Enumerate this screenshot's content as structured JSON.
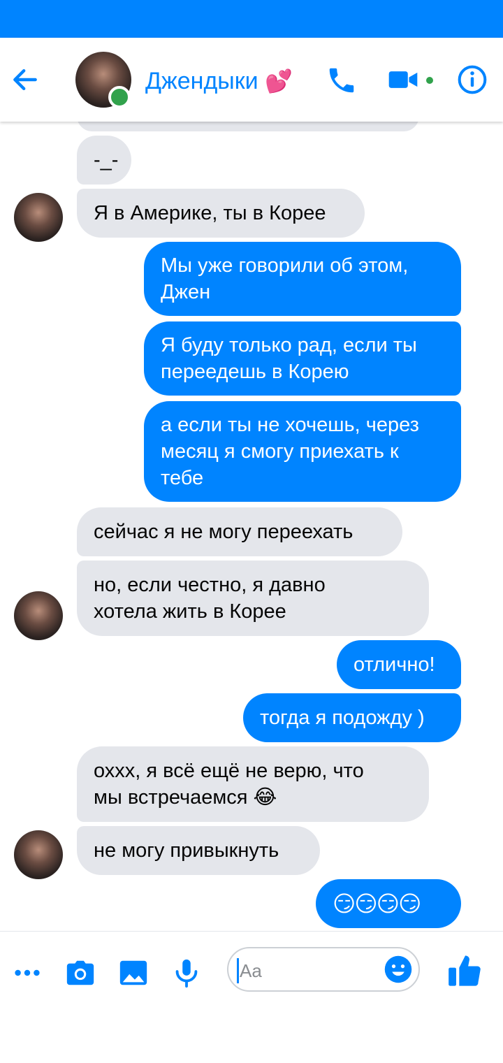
{
  "header": {
    "title": "Джендыки",
    "title_emoji": "💕",
    "back_icon": "arrow-left-icon",
    "call_icon": "phone-icon",
    "video_icon": "video-camera-icon",
    "info_icon": "info-icon",
    "online": true
  },
  "messages": [
    {
      "from": "them",
      "text": "-_-"
    },
    {
      "from": "them",
      "text": "Я в Америке, ты в Корее"
    },
    {
      "from": "me",
      "text": "Мы уже говорили об этом,\nДжен"
    },
    {
      "from": "me",
      "text": "Я буду только рад, если ты\nпереедешь в Корею"
    },
    {
      "from": "me",
      "text": "а если ты не хочешь, через\nмесяц я смогу приехать к\nтебе"
    },
    {
      "from": "them",
      "text": "сейчас я не могу переехать"
    },
    {
      "from": "them",
      "text": "но, если честно, я давно\nхотела жить в Корее"
    },
    {
      "from": "me",
      "text": "отлично!"
    },
    {
      "from": "me",
      "text": "тогда я подожду )"
    },
    {
      "from": "them",
      "text": "оххх, я всё ещё не верю, что\nмы встречаемся 😂"
    },
    {
      "from": "them",
      "text": "не могу привыкнуть"
    },
    {
      "from": "me",
      "text": "😏😏😏😏"
    }
  ],
  "composer": {
    "placeholder": "Aa",
    "icons": [
      "more-dots-icon",
      "camera-icon",
      "image-icon",
      "microphone-icon",
      "emoji-icon",
      "thumbs-up-icon"
    ]
  },
  "colors": {
    "accent": "#0084ff",
    "incoming_bubble": "#e4e6eb",
    "online": "#31a24c"
  }
}
